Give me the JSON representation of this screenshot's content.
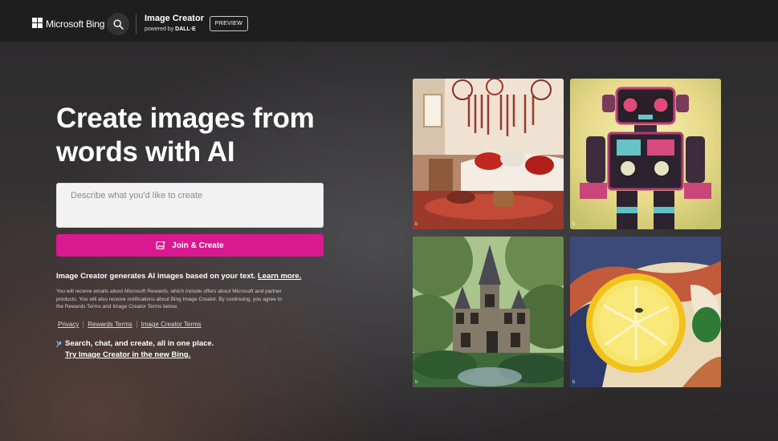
{
  "header": {
    "brand": "Microsoft Bing",
    "app_title": "Image Creator",
    "powered_by": "powered by",
    "powered_by_model": "DALL·E",
    "badge": "PREVIEW",
    "icons": {
      "logo": "microsoft-logo",
      "search": "search-icon"
    }
  },
  "hero": {
    "headline": "Create images from words with AI",
    "prompt_placeholder": "Describe what you'd like to create",
    "prompt_value": "",
    "join_button": "Join & Create",
    "join_icon": "image-sparkle-icon"
  },
  "info": {
    "text": "Image Creator generates AI images based on your text.",
    "learn_more": "Learn more.",
    "fine_print": "You will receive emails about Microsoft Rewards, which include offers about Microsoft and partner products. You will also receive notifications about Bing Image Creator. By continuing, you agree to the Rewards Terms and Image Creator Terms below."
  },
  "links": [
    "Privacy",
    "Rewards Terms",
    "Image Creator Terms"
  ],
  "promo": {
    "line1": "Search, chat, and create, all in one place.",
    "line2": "Try Image Creator in the new Bing.",
    "icon": "bing-sparkle-icon"
  },
  "gallery": {
    "tiles": [
      {
        "subject": "bohemian-living-room-image",
        "mark": "b"
      },
      {
        "subject": "retro-robot-image",
        "mark": "b"
      },
      {
        "subject": "forest-castle-image",
        "mark": "b"
      },
      {
        "subject": "abstract-lemon-image",
        "mark": "b"
      }
    ]
  },
  "colors": {
    "accent": "#d9198f",
    "header_bg": "#1e1e1e",
    "page_bg": "#2a2829"
  }
}
